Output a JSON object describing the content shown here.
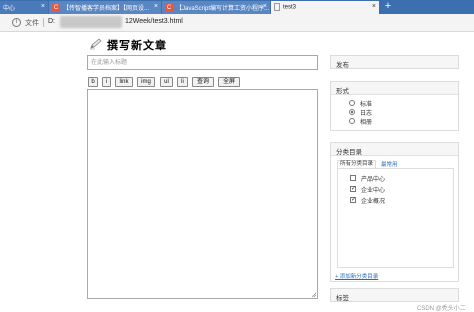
{
  "browser": {
    "tabs": [
      {
        "label": "中心",
        "icon": "",
        "active": false
      },
      {
        "label": "【传智播客学员档案】【网页设...",
        "icon": "C",
        "active": false
      },
      {
        "label": "【JavaScript编写计算工资小程序...",
        "icon": "C",
        "active": false
      },
      {
        "label": "test3",
        "icon": "doc-icon",
        "active": true
      }
    ],
    "close_glyph": "×",
    "new_tab_glyph": "+",
    "address": {
      "info_glyph": "i",
      "scheme_label": "文件",
      "url_prefix": "D:",
      "url_suffix": "12Week/test3.html"
    }
  },
  "editor": {
    "heading": "撰写新文章",
    "title_placeholder": "在此输入标题",
    "toolbar": [
      "b",
      "i",
      "link",
      "img",
      "ul",
      "li",
      "查询",
      "全屏"
    ]
  },
  "sidebar": {
    "publish": {
      "label": "发布"
    },
    "format": {
      "label": "形式",
      "options": [
        {
          "label": "标准",
          "selected": false
        },
        {
          "label": "日志",
          "selected": true
        },
        {
          "label": "相册",
          "selected": false
        }
      ]
    },
    "category": {
      "label": "分类目录",
      "tab_all": "所有分类目录",
      "tab_common": "最常用",
      "items": [
        {
          "label": "产品中心",
          "checked": false
        },
        {
          "label": "企业中心",
          "checked": true
        },
        {
          "label": "企业概况",
          "checked": true
        }
      ],
      "add_link": "+ 添加新分类目录"
    },
    "tags": {
      "label": "标签"
    }
  },
  "watermark": "CSDN @秃头小二",
  "colors": {
    "tab_bar": "#3b6fb0",
    "link": "#2a6bb8",
    "favicon": "#e8573e"
  }
}
